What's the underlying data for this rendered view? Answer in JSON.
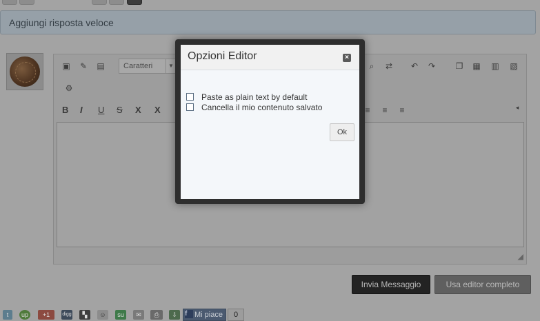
{
  "header": {
    "title": "Aggiungi risposta veloce"
  },
  "editor": {
    "font_select": "Caratteri",
    "format_buttons": [
      "B",
      "I",
      "U",
      "S",
      "X",
      "X"
    ]
  },
  "actions": {
    "send_label": "Invia Messaggio",
    "full_editor_label": "Usa editor completo"
  },
  "share": {
    "gplus_label": "+1",
    "like_label": "Mi piace",
    "like_count": "0",
    "up_label": "up",
    "digg_label": "digg",
    "su_label": "su"
  },
  "modal": {
    "title": "Opzioni Editor",
    "options": [
      {
        "label": "Paste as plain text by default",
        "checked": false
      },
      {
        "label": "Cancella il mio contenuto salvato",
        "checked": false
      }
    ],
    "ok_label": "Ok"
  },
  "colors": {
    "overlay": "#a3a3a3",
    "modal_frame": "#2e2e2e",
    "modal_body": "#f4f7fa",
    "send_button": "#232323"
  }
}
